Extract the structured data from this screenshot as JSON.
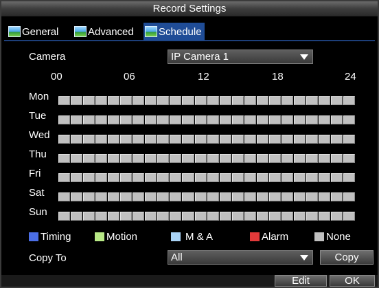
{
  "window": {
    "title": "Record Settings"
  },
  "tabs": [
    {
      "label": "General",
      "active": false
    },
    {
      "label": "Advanced",
      "active": false
    },
    {
      "label": "Schedule",
      "active": true
    }
  ],
  "camera": {
    "label": "Camera",
    "value": "IP Camera 1"
  },
  "hours": [
    "00",
    "06",
    "12",
    "18",
    "24"
  ],
  "days": [
    "Mon",
    "Tue",
    "Wed",
    "Thu",
    "Fri",
    "Sat",
    "Sun"
  ],
  "slots_per_day": 24,
  "legend": [
    {
      "label": "Timing",
      "color": "#4b6ee6"
    },
    {
      "label": "Motion",
      "color": "#b8e986"
    },
    {
      "label": "M & A",
      "color": "#a9d3f5"
    },
    {
      "label": "Alarm",
      "color": "#e23a3a"
    },
    {
      "label": "None",
      "color": "#c0c0c0"
    }
  ],
  "copy_to": {
    "label": "Copy To",
    "value": "All",
    "button": "Copy"
  },
  "footer": {
    "edit": "Edit",
    "ok": "OK"
  }
}
